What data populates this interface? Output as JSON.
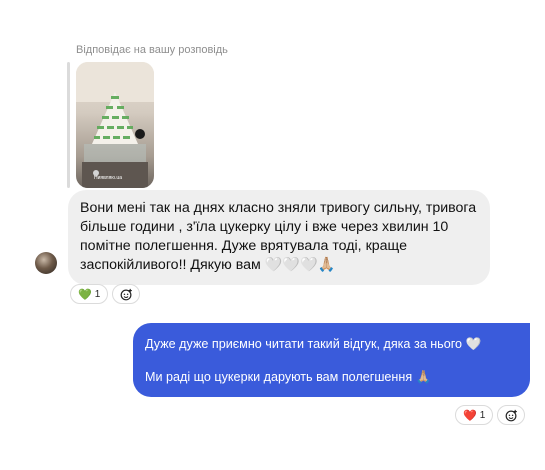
{
  "reply_label": "Відповідає на вашу розповідь",
  "story": {
    "username": "Ниявляю.ua"
  },
  "incoming": {
    "text": "Вони мені так на днях класно зняли тривогу сильну, тривога більше години , з'їла цукерку цілу і вже через хвилин 10 помітне полегшення. Дуже врятувала тоді, краще заспокійливого!! Дякую вам 🤍🤍🤍🙏🏼",
    "reaction": {
      "emoji": "💚",
      "count": "1"
    }
  },
  "outgoing": {
    "line1": "Дуже дуже приємно читати такий відгук, дяка за нього 🤍",
    "line2": "Ми раді що цукерки дарують вам полегшення 🙏🏼",
    "reaction": {
      "emoji": "❤️",
      "count": "1"
    }
  },
  "icons": {
    "add_reaction": "smile-plus-icon"
  },
  "colors": {
    "outgoing_bubble": "#3a5bdb",
    "incoming_bubble": "#efefef"
  }
}
